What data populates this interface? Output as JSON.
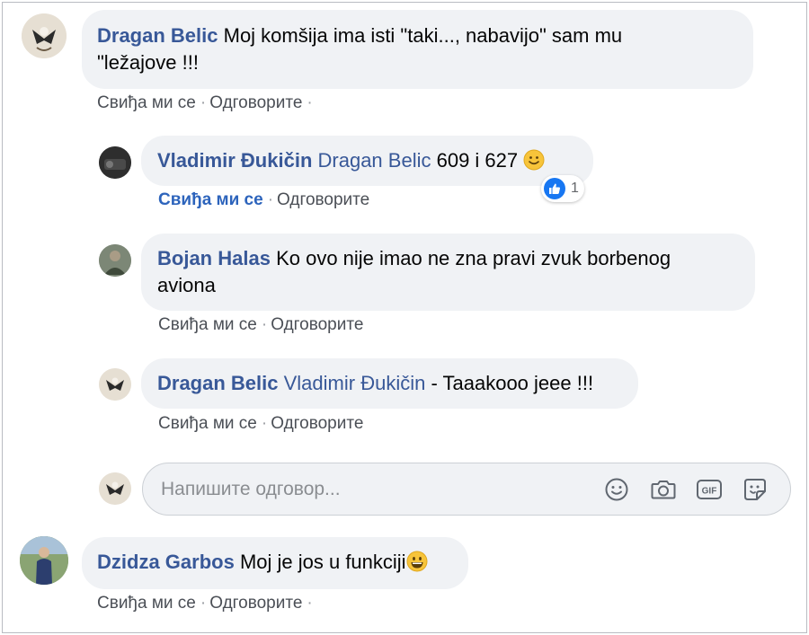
{
  "comments": [
    {
      "author": "Dragan Belic",
      "text_line1": "Moj komšija ima isti \"taki..., nabavijo\" sam mu",
      "text_line2": "\"ležajove !!!",
      "like_label": "Свиђа ми се",
      "reply_label": "Одговорите"
    },
    {
      "author": "Vladimir Đukičin",
      "mention": "Dragan Belic",
      "text": "609 i 627",
      "emoji": "slightly-smiling-face",
      "like_label": "Свиђа ми се",
      "reply_label": "Одговорите",
      "reaction_count": "1",
      "liked": true
    },
    {
      "author": "Bojan Halas",
      "text_line1": "Ko ovo nije imao ne zna pravi zvuk borbenog",
      "text_line2": "aviona",
      "like_label": "Свиђа ми се",
      "reply_label": "Одговорите"
    },
    {
      "author": "Dragan Belic",
      "mention": "Vladimir Đukičin",
      "text": "- Taaakooo jeee !!!",
      "like_label": "Свиђа ми се",
      "reply_label": "Одговорите"
    },
    {
      "author": "Dzidza Garbos",
      "text": "Moj je jos u funkciji",
      "emoji": "grinning-face",
      "like_label": "Свиђа ми се",
      "reply_label": "Одговорите"
    }
  ],
  "reply_box": {
    "placeholder": "Напишите одговор...",
    "icons": [
      "emoji-icon",
      "camera-icon",
      "gif-icon",
      "sticker-icon"
    ]
  },
  "colors": {
    "author": "#385898",
    "bubble": "#f0f2f5",
    "liked": "#2d64bc",
    "like_reaction": "#1877f2"
  }
}
